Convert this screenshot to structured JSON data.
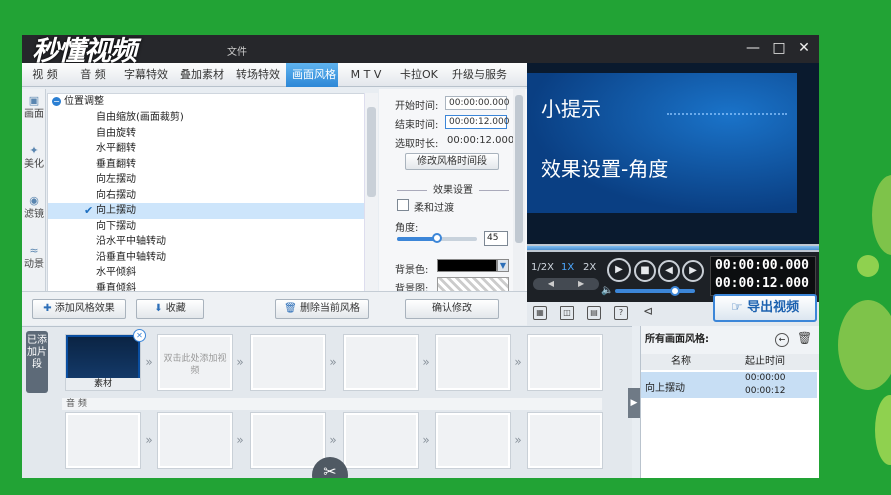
{
  "window": {
    "logo": "秒懂视频",
    "title_suffix": "文件"
  },
  "tabs": [
    {
      "label": "视 频"
    },
    {
      "label": "音 频"
    },
    {
      "label": "字幕特效"
    },
    {
      "label": "叠加素材"
    },
    {
      "label": "转场特效"
    },
    {
      "label": "画面风格",
      "active": true
    },
    {
      "label": "M T V"
    },
    {
      "label": "卡拉OK"
    },
    {
      "label": "升级与服务"
    }
  ],
  "side_tabs": [
    {
      "label": "画面",
      "icon": "frame-icon"
    },
    {
      "label": "美化",
      "icon": "wand-icon"
    },
    {
      "label": "滤镜",
      "icon": "filter-icon"
    },
    {
      "label": "动景",
      "icon": "wave-icon"
    }
  ],
  "tree": {
    "root": "位置调整",
    "items": [
      "自由缩放(画面裁剪)",
      "自由旋转",
      "水平翻转",
      "垂直翻转",
      "向左摆动",
      "向右摆动",
      "向上摆动",
      "向下摆动",
      "沿水平中轴转动",
      "沿垂直中轴转动",
      "水平倾斜",
      "垂直倾斜"
    ],
    "selected_index": 6
  },
  "settings": {
    "start_label": "开始时间:",
    "start_value": "00:00:00.000",
    "end_label": "结束时间:",
    "end_value": "00:00:12.000",
    "duration_label": "选取时长:",
    "duration_value": "00:00:12.000",
    "modify_time_button": "修改风格时间段",
    "effect_title": "效果设置",
    "soft_label": "柔和过渡",
    "angle_label": "角度:",
    "angle_value": "45",
    "angle_level": 0.5,
    "bg_color_label": "背景色:",
    "bg_image_label": "背景图:",
    "confirm_button": "确认修改"
  },
  "toolbar": {
    "add_button": "添加风格效果",
    "favorite_button": "收藏",
    "delete_button": "删除当前风格"
  },
  "preview": {
    "tip_title": "小提示",
    "tip_text": "效果设置-角度"
  },
  "player": {
    "speed_half": "1/2X",
    "speed_1x": "1X",
    "speed_2x": "2X",
    "time_current": "00:00:00.000",
    "time_total": "00:00:12.000",
    "volume_level": 0.75
  },
  "export_button": "导出视频",
  "timeline": {
    "added_tab": "已添加片段",
    "clip_label": "素材",
    "empty_hint": "双击此处添加视频",
    "audio_label": "音 频"
  },
  "right_panel": {
    "title": "所有画面风格:",
    "col_name": "名称",
    "col_time": "起止时间",
    "row_name": "向上摆动",
    "row_start": "00:00:00",
    "row_end": "00:00:12"
  },
  "colors": {
    "accent": "#2d87d7",
    "bg_green": "#22a335"
  }
}
